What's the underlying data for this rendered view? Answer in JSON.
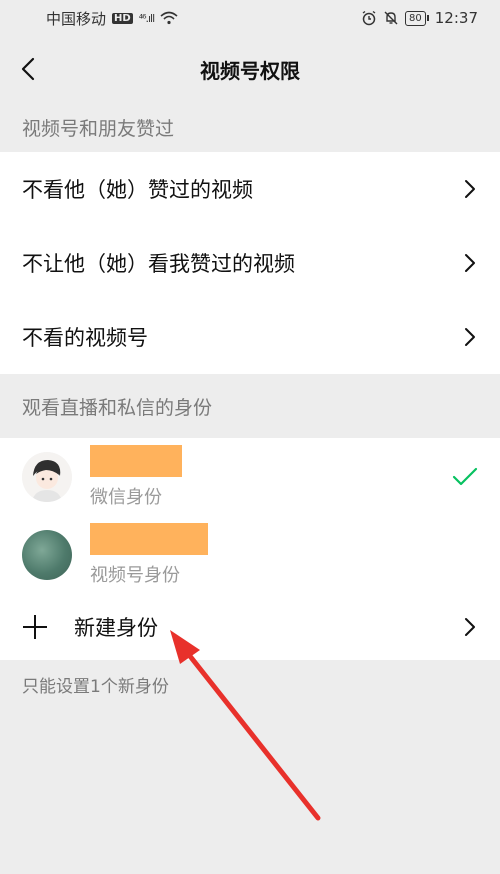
{
  "status_bar": {
    "carrier": "中国移动",
    "hd": "HD",
    "signal": "⁴⁶.ıll",
    "battery": "80",
    "time": "12:37"
  },
  "nav": {
    "title": "视频号权限"
  },
  "section_likes": {
    "header": "视频号和朋友赞过",
    "items": [
      {
        "label": "不看他（她）赞过的视频"
      },
      {
        "label": "不让他（她）看我赞过的视频"
      },
      {
        "label": "不看的视频号"
      }
    ]
  },
  "section_identity": {
    "header": "观看直播和私信的身份",
    "identities": [
      {
        "subtitle": "微信身份",
        "selected": true
      },
      {
        "subtitle": "视频号身份",
        "selected": false
      }
    ],
    "new_label": "新建身份",
    "footnote": "只能设置1个新身份"
  },
  "colors": {
    "check": "#07c160",
    "redaction": "#ffb25c",
    "annotation_arrow": "#e8312b"
  }
}
